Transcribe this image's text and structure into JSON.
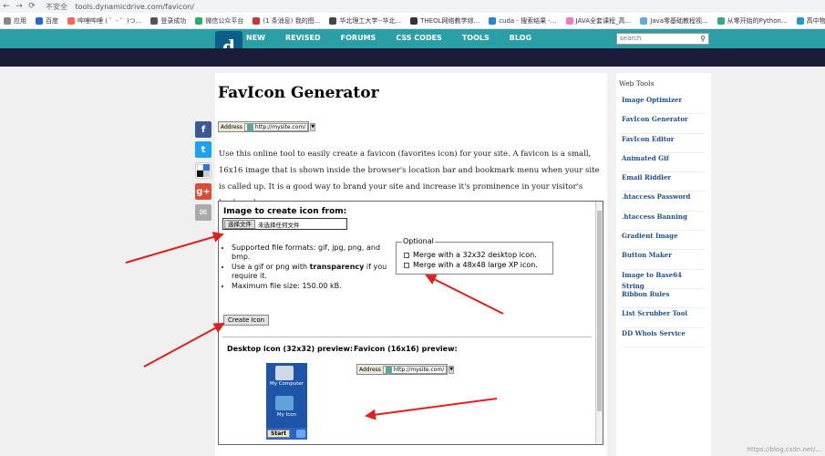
{
  "browser": {
    "insecure_label": "不安全",
    "url": "tools.dynamicdrive.com/favicon/",
    "bookmarks": [
      "应用",
      "百度",
      "哔哩哔哩 ( ゜- ゜)つ...",
      "登录成功",
      "微信公众平台",
      "(1 条消息) 我的图...",
      "华北理工大学--华北...",
      "THEOL网络教学综...",
      "cuda - 搜索结果 -...",
      "JAVA全套课程_高...",
      "Java零基础教程视...",
      "从零开始的Python...",
      "高中物理--教师资..."
    ]
  },
  "site_nav": {
    "logo_letter": "d",
    "links": [
      "NEW",
      "REVISED",
      "FORUMS",
      "CSS CODES",
      "TOOLS",
      "BLOG"
    ],
    "search_placeholder": "search"
  },
  "page": {
    "title": "FavIcon Generator",
    "address_label": "Address",
    "address_url": "http://mysite.com/",
    "intro": "Use this online tool to easily create a favicon (favorites icon) for your site. A favicon is a small, 16x16 image that is shown inside the browser's location bar and bookmark menu when your site is called up. It is a good way to brand your site and increase it's prominence in your visitor's bookmark menu."
  },
  "tool": {
    "heading": "Image to create icon from:",
    "file_button": "选择文件",
    "file_status": "未选择任何文件",
    "bullets": [
      "Supported file formats: gif, jpg, png, and bmp.",
      "Use a gif or png with transparency if you require it.",
      "Maximum file size: 150.00 kB."
    ],
    "optional_legend": "Optional",
    "optional_items": [
      "Merge with a 32x32 desktop icon.",
      "Merge with a 48x48 large XP icon."
    ],
    "create_button": "Create Icon",
    "desktop_preview_label": "Desktop icon (32x32) preview:",
    "favicon_preview_label": "Favicon (16x16) preview:",
    "desktop_icon_1": "My Computer",
    "desktop_icon_2": "My Icon",
    "start_label": "Start"
  },
  "sidebar": {
    "heading": "Web Tools",
    "items": [
      "Image Optimizer",
      "FavIcon Generator",
      "FavIcon Editor",
      "Animated Gif",
      "Email Riddler",
      ".htaccess Password",
      ".htaccess Banning",
      "Gradient Image",
      "Button Maker",
      "Image to Base64 String",
      "Ribbon Rules",
      "List Scrubber Tool",
      "DD Whois Service"
    ]
  },
  "share": [
    "f",
    "t",
    "d",
    "g+",
    "✉"
  ],
  "colors": {
    "nav_teal": "#2a9fa6",
    "dark_band": "#1b1b3a",
    "link_blue": "#1f4f8f",
    "arrow_red": "#e0201d"
  },
  "watermark": "https://blog.csdn.net/..."
}
